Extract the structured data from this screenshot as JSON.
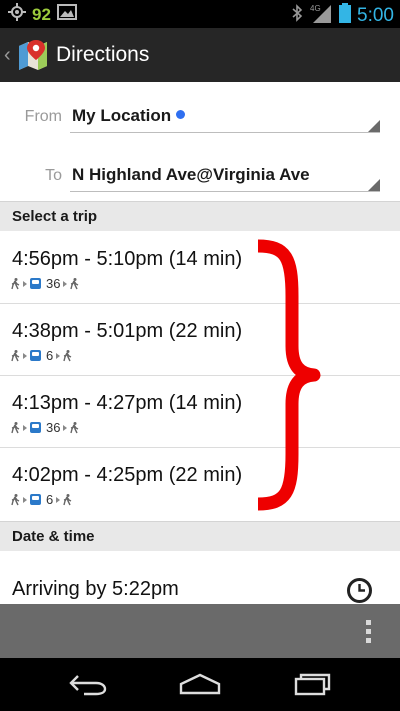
{
  "status_bar": {
    "notification_count": "92",
    "network": "4G",
    "time": "5:00"
  },
  "action_bar": {
    "title": "Directions",
    "icon": "google-maps-icon"
  },
  "form": {
    "from_label": "From",
    "from_value": "My Location",
    "to_label": "To",
    "to_value": "N Highland Ave@Virginia Ave"
  },
  "select_trip_header": "Select a trip",
  "trips": [
    {
      "time": "4:56pm - 5:10pm (14 min)",
      "route": "36"
    },
    {
      "time": "4:38pm - 5:01pm (22 min)",
      "route": "6"
    },
    {
      "time": "4:13pm - 4:27pm (14 min)",
      "route": "36"
    },
    {
      "time": "4:02pm - 4:25pm (22 min)",
      "route": "6"
    }
  ],
  "date_time_header": "Date & time",
  "arriving": "Arriving by 5:22pm",
  "colors": {
    "annotation": "#ee0000",
    "accent": "#33b5e5",
    "bus": "#2b79c9"
  }
}
